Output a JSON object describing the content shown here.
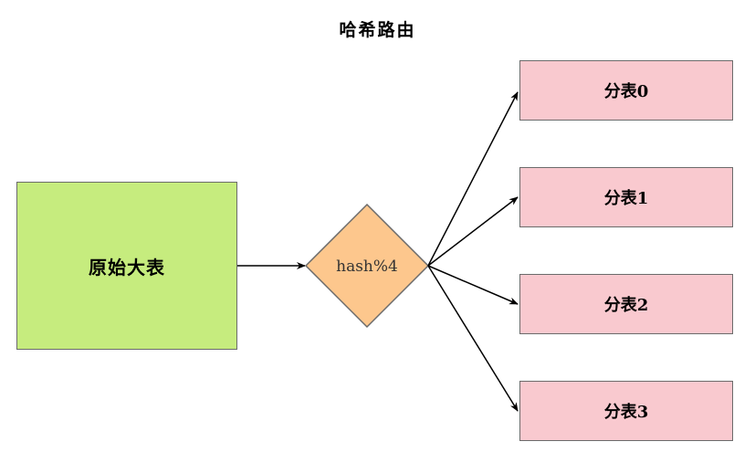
{
  "diagram": {
    "title": "哈希路由",
    "source_table": "原始大表",
    "router": "hash%4",
    "shards": [
      {
        "label": "分表0"
      },
      {
        "label": "分表1"
      },
      {
        "label": "分表2"
      },
      {
        "label": "分表3"
      }
    ],
    "colors": {
      "source_fill": "#c6ec7e",
      "router_fill": "#fdc78d",
      "shard_fill": "#f9c9cf",
      "border": "#6b6b6b",
      "arrow": "#000000"
    }
  }
}
